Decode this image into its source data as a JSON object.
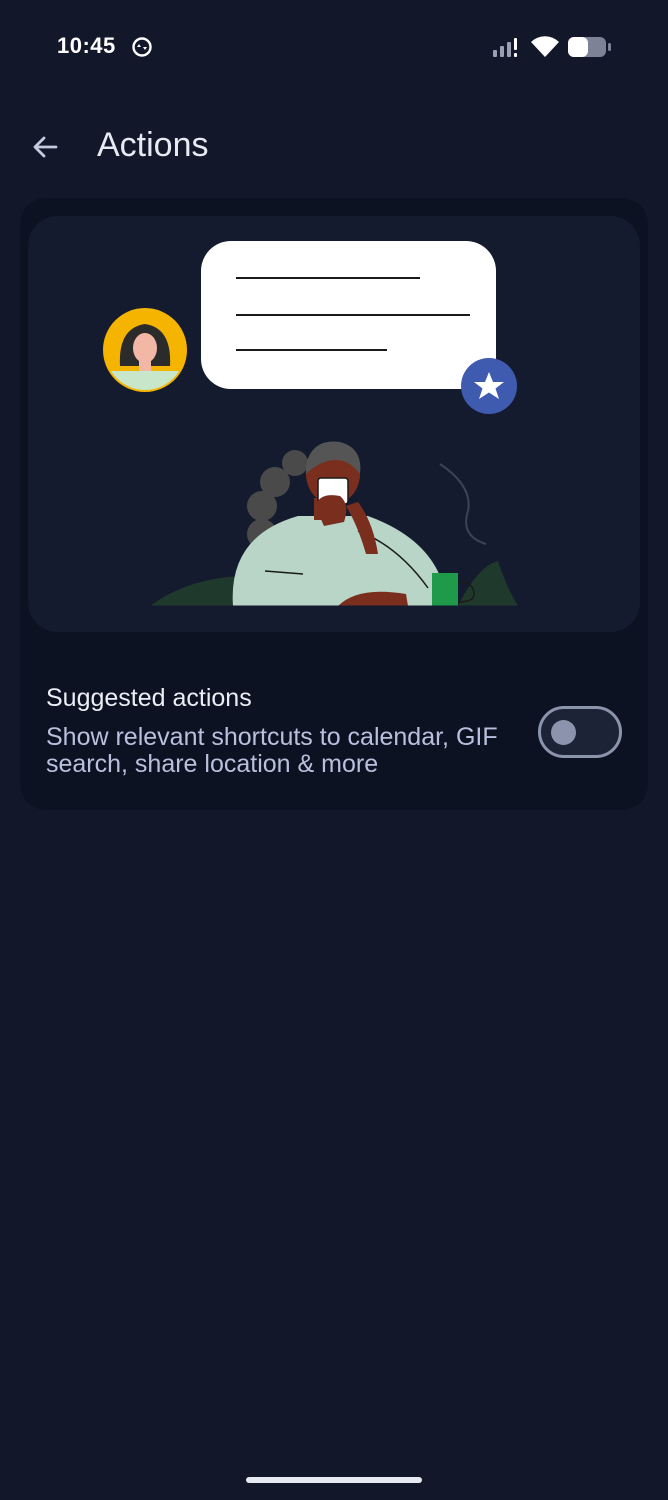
{
  "status_bar": {
    "time": "10:45",
    "icons": [
      "sync-icon",
      "signal-icon",
      "wifi-icon",
      "battery-icon"
    ]
  },
  "app_bar": {
    "back_icon": "arrow-back-icon",
    "title": "Actions"
  },
  "illustration": {
    "description_icons": [
      "avatar-icon",
      "chat-bubble",
      "star-badge-icon",
      "person-with-phone",
      "coffee-mug"
    ]
  },
  "setting": {
    "title": "Suggested actions",
    "description": "Show relevant shortcuts to calendar, GIF search, share location & more",
    "enabled": false
  },
  "colors": {
    "background": "#12172a",
    "card": "#0d1223",
    "panel": "#151b2e",
    "star_badge": "#3f5bb0",
    "avatar_bg": "#f4b400",
    "mug": "#1e9a4a"
  }
}
